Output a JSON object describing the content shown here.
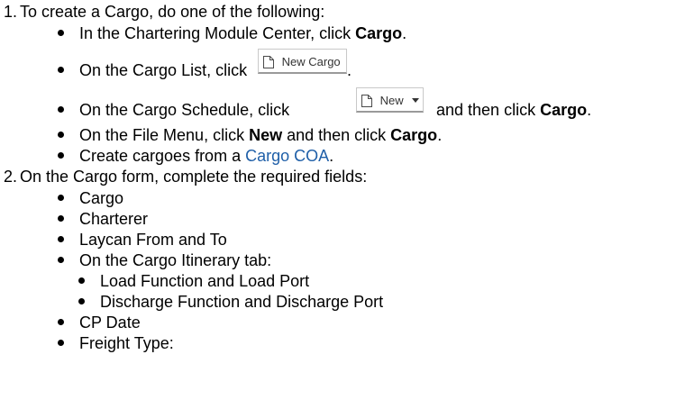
{
  "steps": [
    {
      "number": "1.",
      "text": "To create a Cargo, do one of the following:",
      "items": [
        {
          "prefix": "In the Chartering Module Center, click ",
          "bold": "Cargo",
          "suffix": "."
        },
        {
          "prefix": "On the Cargo List, click ",
          "button_label": "New Cargo",
          "suffix": "."
        },
        {
          "prefix": "On the Cargo Schedule, click ",
          "button_label": "New",
          "middle": " and then click ",
          "bold": "Cargo",
          "suffix": "."
        },
        {
          "prefix": "On the File Menu, click ",
          "bold1": "New",
          "middle": " and then click ",
          "bold2": "Cargo",
          "suffix": "."
        },
        {
          "prefix": "Create cargoes from a ",
          "link": "Cargo COA",
          "suffix": "."
        }
      ]
    },
    {
      "number": "2.",
      "text": "On the Cargo form, complete the required fields:",
      "items": [
        "Cargo",
        "Charterer",
        "Laycan From and To",
        "On the Cargo Itinerary tab:",
        "CP Date",
        "Freight Type:"
      ],
      "subitems": [
        "Load Function and Load Port",
        "Discharge Function and Discharge Port"
      ]
    }
  ],
  "icons": {
    "new_document": "document-icon",
    "dropdown": "caret-down-icon"
  },
  "colors": {
    "link": "#1f5fa8",
    "text": "#000000"
  }
}
